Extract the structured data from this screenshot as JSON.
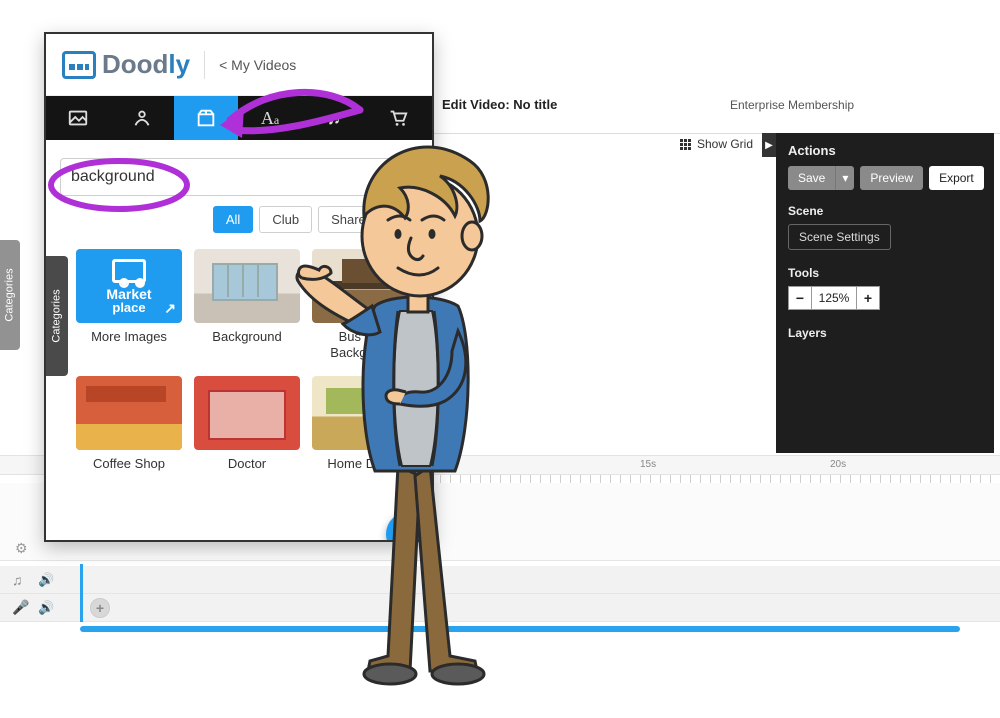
{
  "header": {
    "edit_title": "Edit Video: No title",
    "membership": "Enterprise Membership",
    "show_grid": "Show Grid"
  },
  "right_panel": {
    "title": "Actions",
    "save": "Save",
    "preview": "Preview",
    "export": "Export",
    "scene_title": "Scene",
    "scene_settings": "Scene Settings",
    "tools_title": "Tools",
    "zoom_value": "125%",
    "layers_title": "Layers"
  },
  "timeline": {
    "mark15": "15s",
    "mark20": "20s"
  },
  "popup": {
    "logo_main": "Dood",
    "logo_suffix": "ly",
    "back": "< My Videos",
    "search_value": "background",
    "categories": "Categories",
    "filters": {
      "all": "All",
      "club": "Club",
      "shared": "Shared"
    },
    "tiles": [
      {
        "label": "More Images",
        "market_l1": "Market",
        "market_l2": "place"
      },
      {
        "label": "Background"
      },
      {
        "label": "Bus Stop Background"
      },
      {
        "label": "Coffee Shop"
      },
      {
        "label": "Doctor"
      },
      {
        "label": "Home Dining"
      }
    ]
  }
}
